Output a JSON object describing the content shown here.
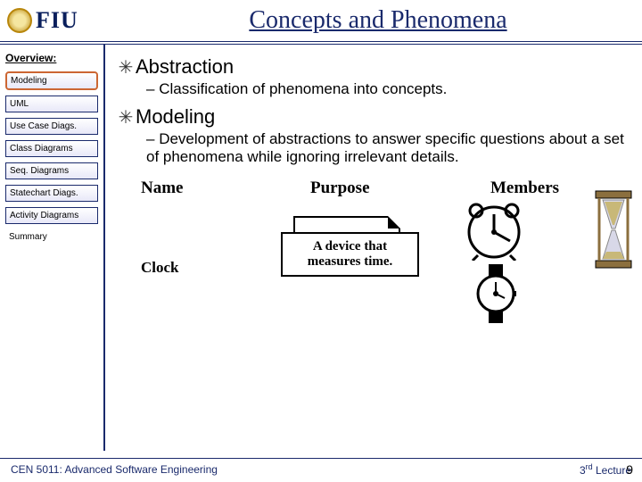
{
  "header": {
    "logo_text": "FIU",
    "title": "Concepts and Phenomena"
  },
  "sidebar": {
    "heading": "Overview:",
    "items": [
      {
        "label": "Modeling",
        "active": true
      },
      {
        "label": "UML"
      },
      {
        "label": "Use Case Diags."
      },
      {
        "label": "Class Diagrams"
      },
      {
        "label": "Seq. Diagrams"
      },
      {
        "label": "Statechart Diags."
      },
      {
        "label": "Activity Diagrams"
      },
      {
        "label": "Summary",
        "plain": true
      }
    ]
  },
  "content": {
    "b1": "Abstraction",
    "b1_sub": "Classification of phenomena into concepts.",
    "b2": "Modeling",
    "b2_sub": "Development of abstractions to answer specific questions about a set of phenomena while ignoring irrelevant details."
  },
  "table": {
    "col1": "Name",
    "col2": "Purpose",
    "col3": "Members",
    "row1_name": "Clock",
    "row1_purpose": "A device that measures time."
  },
  "footer": {
    "left": "CEN 5011: Advanced Software Engineering",
    "right_ord": "3",
    "right_suffix": "rd",
    "right_rest": " Lecture",
    "page": "9"
  }
}
